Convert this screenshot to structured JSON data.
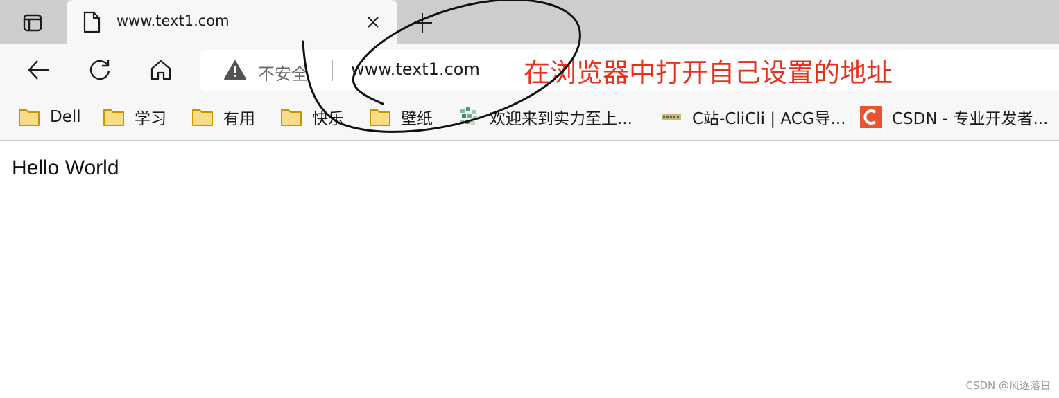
{
  "tab": {
    "title": "www.text1.com"
  },
  "address_bar": {
    "security_label": "不安全",
    "url": "www.text1.com"
  },
  "annotation": {
    "text": "在浏览器中打开自己设置的地址"
  },
  "bookmarks": [
    {
      "label": "Dell",
      "icon": "folder-icon"
    },
    {
      "label": "学习",
      "icon": "folder-icon"
    },
    {
      "label": "有用",
      "icon": "folder-icon"
    },
    {
      "label": "快乐",
      "icon": "folder-icon"
    },
    {
      "label": "壁纸",
      "icon": "folder-icon"
    },
    {
      "label": "欢迎来到实力至上...",
      "icon": "site-favicon"
    },
    {
      "label": "C站-CliCli | ACG导...",
      "icon": "clicli-favicon"
    },
    {
      "label": "CSDN - 专业开发者...",
      "icon": "csdn-favicon"
    }
  ],
  "page": {
    "body_text": "Hello World"
  },
  "watermark": {
    "text": "CSDN @风逐落日"
  },
  "colors": {
    "annotation": "#e8301a",
    "folder_fill": "#f9dc86",
    "folder_stroke": "#c79400",
    "csdn_brand": "#e9542c"
  }
}
